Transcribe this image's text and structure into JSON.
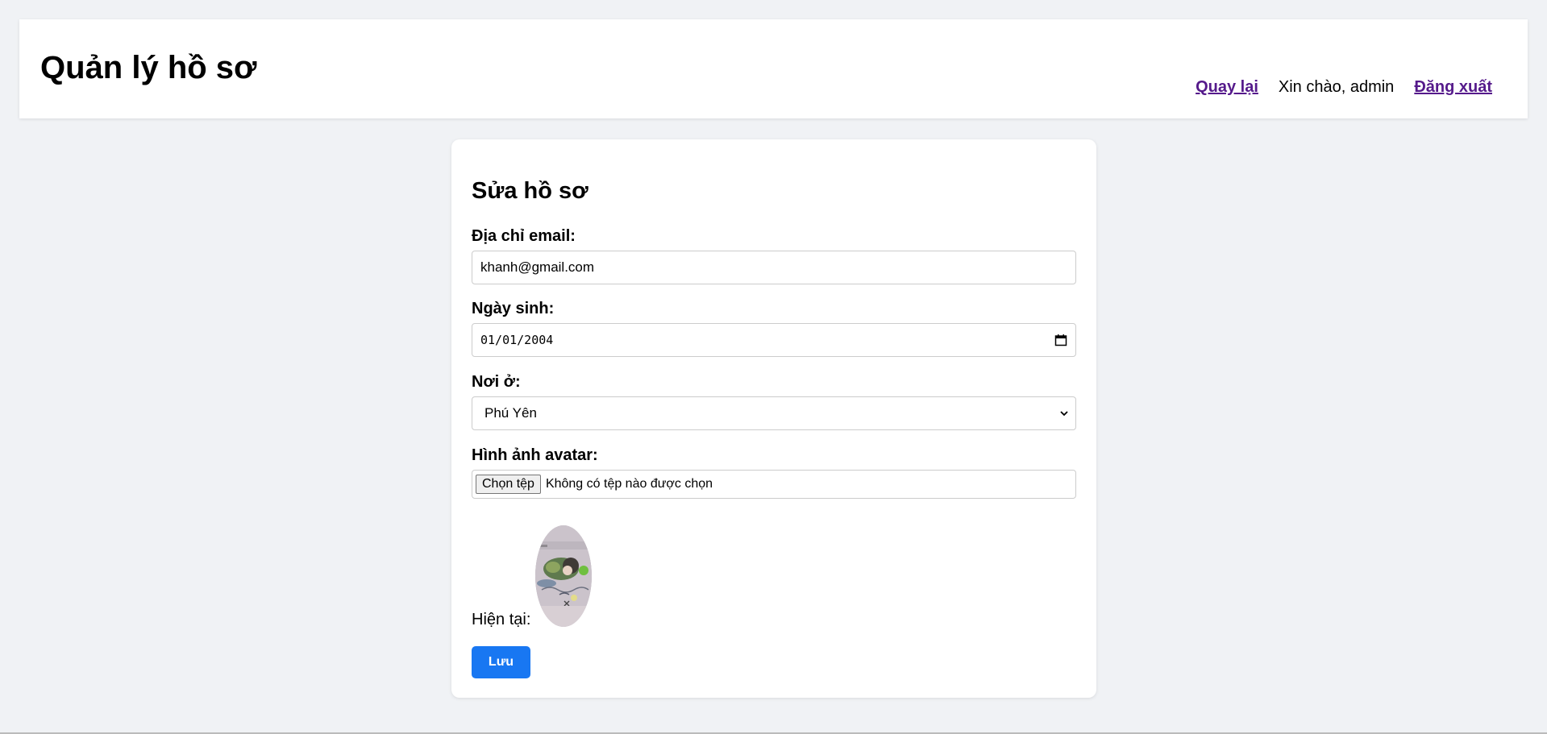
{
  "header": {
    "title": "Quản lý hồ sơ",
    "back_label": "Quay lại",
    "greeting": "Xin chào, admin",
    "logout_label": "Đăng xuất"
  },
  "form": {
    "title": "Sửa hồ sơ",
    "email": {
      "label": "Địa chỉ email:",
      "value": "khanh@gmail.com"
    },
    "birthdate": {
      "label": "Ngày sinh:",
      "value": "01/01/2004"
    },
    "residence": {
      "label": "Nơi ở:",
      "selected": "Phú Yên"
    },
    "avatar": {
      "label": "Hình ảnh avatar:",
      "choose_button": "Chọn tệp",
      "no_file_text": "Không có tệp nào được chọn",
      "current_label": "Hiện tại:"
    },
    "save_label": "Lưu"
  },
  "colors": {
    "page_bg": "#f0f2f5",
    "link": "#551a8b",
    "primary": "#1877f2"
  }
}
